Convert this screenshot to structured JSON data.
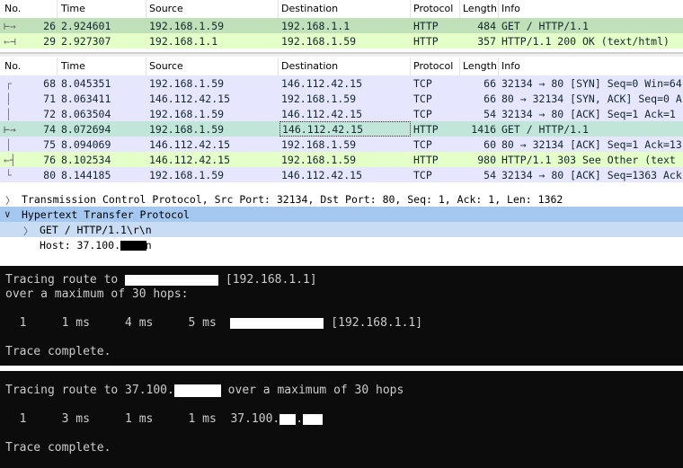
{
  "top_list": {
    "columns": [
      "No.",
      "Time",
      "Source",
      "Destination",
      "Protocol",
      "Length",
      "Info"
    ],
    "rows": [
      {
        "no": "26",
        "time": "2.924601",
        "source": "192.168.1.59",
        "destination": "192.168.1.1",
        "protocol": "HTTP",
        "length": "484",
        "info": "GET / HTTP/1.1"
      },
      {
        "no": "29",
        "time": "2.927307",
        "source": "192.168.1.1",
        "destination": "192.168.1.59",
        "protocol": "HTTP",
        "length": "357",
        "info": "HTTP/1.1 200 OK  (text/html)"
      }
    ]
  },
  "bottom_list": {
    "columns": [
      "No.",
      "Time",
      "Source",
      "Destination",
      "Protocol",
      "Length",
      "Info"
    ],
    "rows": [
      {
        "no": "68",
        "time": "8.045351",
        "source": "192.168.1.59",
        "destination": "146.112.42.15",
        "protocol": "TCP",
        "length": "66",
        "info": "32134 → 80 [SYN] Seq=0 Win=64"
      },
      {
        "no": "71",
        "time": "8.063411",
        "source": "146.112.42.15",
        "destination": "192.168.1.59",
        "protocol": "TCP",
        "length": "66",
        "info": "80 → 32134 [SYN, ACK] Seq=0 A"
      },
      {
        "no": "72",
        "time": "8.063504",
        "source": "192.168.1.59",
        "destination": "146.112.42.15",
        "protocol": "TCP",
        "length": "54",
        "info": "32134 → 80 [ACK] Seq=1 Ack=1"
      },
      {
        "no": "74",
        "time": "8.072694",
        "source": "192.168.1.59",
        "destination": "146.112.42.15",
        "protocol": "HTTP",
        "length": "1416",
        "info": "GET / HTTP/1.1"
      },
      {
        "no": "75",
        "time": "8.094069",
        "source": "146.112.42.15",
        "destination": "192.168.1.59",
        "protocol": "TCP",
        "length": "60",
        "info": "80 → 32134 [ACK] Seq=1 Ack=13"
      },
      {
        "no": "76",
        "time": "8.102534",
        "source": "146.112.42.15",
        "destination": "192.168.1.59",
        "protocol": "HTTP",
        "length": "980",
        "info": "HTTP/1.1 303 See Other  (text"
      },
      {
        "no": "80",
        "time": "8.144185",
        "source": "192.168.1.59",
        "destination": "146.112.42.15",
        "protocol": "TCP",
        "length": "54",
        "info": "32134 → 80 [ACK] Seq=1363 Ack"
      }
    ]
  },
  "details": {
    "tcp_line": "Transmission Control Protocol, Src Port: 32134, Dst Port: 80, Seq: 1, Ack: 1, Len: 1362",
    "http_line": "Hypertext Transfer Protocol",
    "get_line": "GET / HTTP/1.1\\r\\n",
    "host_prefix": "Host: 37.100.",
    "host_dot": ".",
    "host_suffix": "\\r\\n"
  },
  "terminal1": {
    "line1_prefix": "Tracing route to",
    "line1_ip": "[192.168.1.1]",
    "line2": "over a maximum of 30 hops:",
    "hop_line": "  1     1 ms     4 ms     5 ms",
    "hop_ip": "[192.168.1.1]",
    "complete": "Trace complete."
  },
  "terminal2": {
    "line1_prefix": "Tracing route to 37.100.",
    "line1_suffix": "over a maximum of 30 hops",
    "hop_line": "  1     3 ms     1 ms     1 ms  37.100.",
    "hop_dot": ".",
    "complete": "Trace complete."
  },
  "colors": {
    "http_row": "#e4ffc7",
    "tcp_row": "#e7e6ff",
    "selected_row": "#c2e5da",
    "detail_highlight": "#a5c8f0",
    "terminal_bg": "#0c0c0c",
    "terminal_text": "#cccccc"
  },
  "icons": [
    "related-packet-arrow-icon",
    "expand-arrow-icon",
    "collapse-arrow-icon"
  ]
}
